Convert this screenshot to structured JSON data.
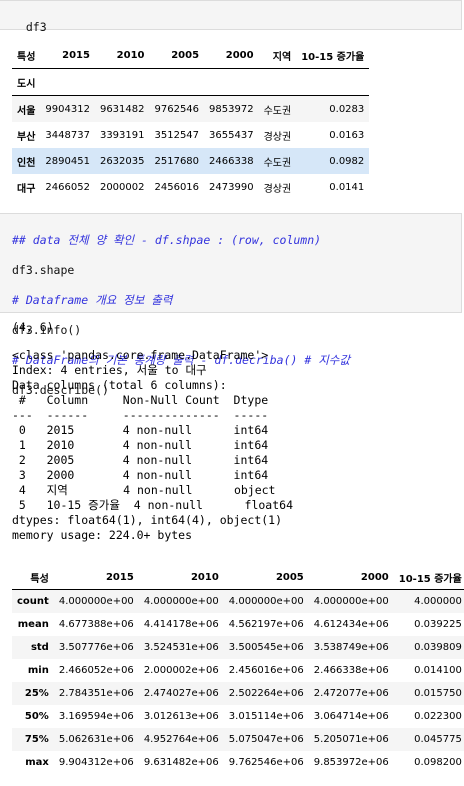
{
  "cell1": {
    "code": "df3"
  },
  "df3_table": {
    "columns": [
      "특성",
      "2015",
      "2010",
      "2005",
      "2000",
      "지역",
      "10-15 증가율"
    ],
    "index_name": "도시",
    "rows": [
      {
        "index": "서울",
        "cells": [
          "9904312",
          "9631482",
          "9762546",
          "9853972",
          "수도권",
          "0.0283"
        ]
      },
      {
        "index": "부산",
        "cells": [
          "3448737",
          "3393191",
          "3512547",
          "3655437",
          "경상권",
          "0.0163"
        ]
      },
      {
        "index": "인천",
        "cells": [
          "2890451",
          "2632035",
          "2517680",
          "2466338",
          "수도권",
          "0.0982"
        ]
      },
      {
        "index": "대구",
        "cells": [
          "2466052",
          "2000002",
          "2456016",
          "2473990",
          "경상권",
          "0.0141"
        ]
      }
    ]
  },
  "cell2": {
    "lines": [
      {
        "text": "## data 전체 양 확인 - df.shpae : (row, column)",
        "kind": "comment"
      },
      {
        "text": "df3.shape",
        "kind": "plain"
      },
      {
        "text": "# Dataframe 개요 정보 출력",
        "kind": "comment"
      },
      {
        "text": "df3.info()",
        "kind": "plain"
      },
      {
        "text": "# DataFrame의 기본 통계량 출력 - df.decriba() # 지수값",
        "kind": "comment"
      },
      {
        "text": "df3.describe()",
        "kind": "plain"
      }
    ]
  },
  "shape_output": "(4, 6)",
  "info_output": "<class 'pandas.core.frame.DataFrame'>\nIndex: 4 entries, 서울 to 대구\nData columns (total 6 columns):\n #   Column     Non-Null Count  Dtype\n---  ------     --------------  -----\n 0   2015       4 non-null      int64\n 1   2010       4 non-null      int64\n 2   2005       4 non-null      int64\n 3   2000       4 non-null      int64\n 4   지역        4 non-null      object\n 5   10-15 증가율  4 non-null      float64\ndtypes: float64(1), int64(4), object(1)\nmemory usage: 224.0+ bytes",
  "describe_table": {
    "columns": [
      "특성",
      "2015",
      "2010",
      "2005",
      "2000",
      "10-15 증가율"
    ],
    "rows": [
      {
        "index": "count",
        "cells": [
          "4.000000e+00",
          "4.000000e+00",
          "4.000000e+00",
          "4.000000e+00",
          "4.000000"
        ]
      },
      {
        "index": "mean",
        "cells": [
          "4.677388e+06",
          "4.414178e+06",
          "4.562197e+06",
          "4.612434e+06",
          "0.039225"
        ]
      },
      {
        "index": "std",
        "cells": [
          "3.507776e+06",
          "3.524531e+06",
          "3.500545e+06",
          "3.538749e+06",
          "0.039809"
        ]
      },
      {
        "index": "min",
        "cells": [
          "2.466052e+06",
          "2.000002e+06",
          "2.456016e+06",
          "2.466338e+06",
          "0.014100"
        ]
      },
      {
        "index": "25%",
        "cells": [
          "2.784351e+06",
          "2.474027e+06",
          "2.502264e+06",
          "2.472077e+06",
          "0.015750"
        ]
      },
      {
        "index": "50%",
        "cells": [
          "3.169594e+06",
          "3.012613e+06",
          "3.015114e+06",
          "3.064714e+06",
          "0.022300"
        ]
      },
      {
        "index": "75%",
        "cells": [
          "5.062631e+06",
          "4.952764e+06",
          "5.075047e+06",
          "5.205071e+06",
          "0.045775"
        ]
      },
      {
        "index": "max",
        "cells": [
          "9.904312e+06",
          "9.631482e+06",
          "9.762546e+06",
          "9.853972e+06",
          "0.098200"
        ]
      }
    ]
  }
}
